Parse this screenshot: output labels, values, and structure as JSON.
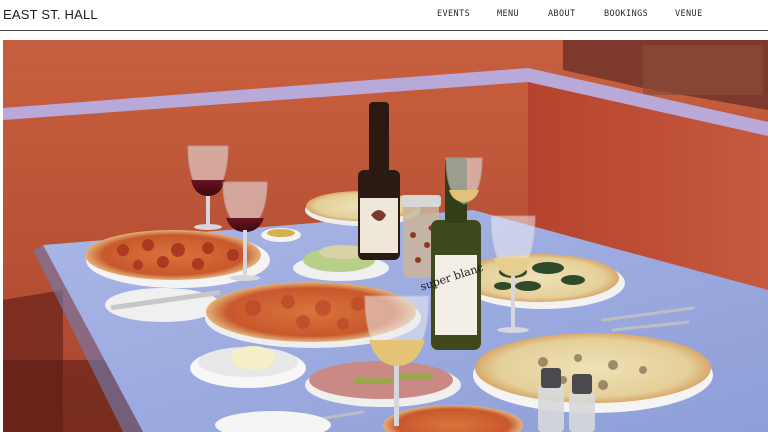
{
  "site": {
    "brand": "EAST ST. HALL"
  },
  "nav": {
    "items": [
      {
        "label": "EVENTS"
      },
      {
        "label": "MENU"
      },
      {
        "label": "ABOUT"
      },
      {
        "label": "BOOKINGS"
      },
      {
        "label": "VENUE"
      }
    ]
  },
  "hero": {
    "bottle_label": "super blanc"
  },
  "colors": {
    "wall": "#c65a3e",
    "wall_shadow": "#9e3f2a",
    "trim": "#b8a7d6",
    "table": "#9faee0",
    "header_border": "#4a4a4a"
  }
}
